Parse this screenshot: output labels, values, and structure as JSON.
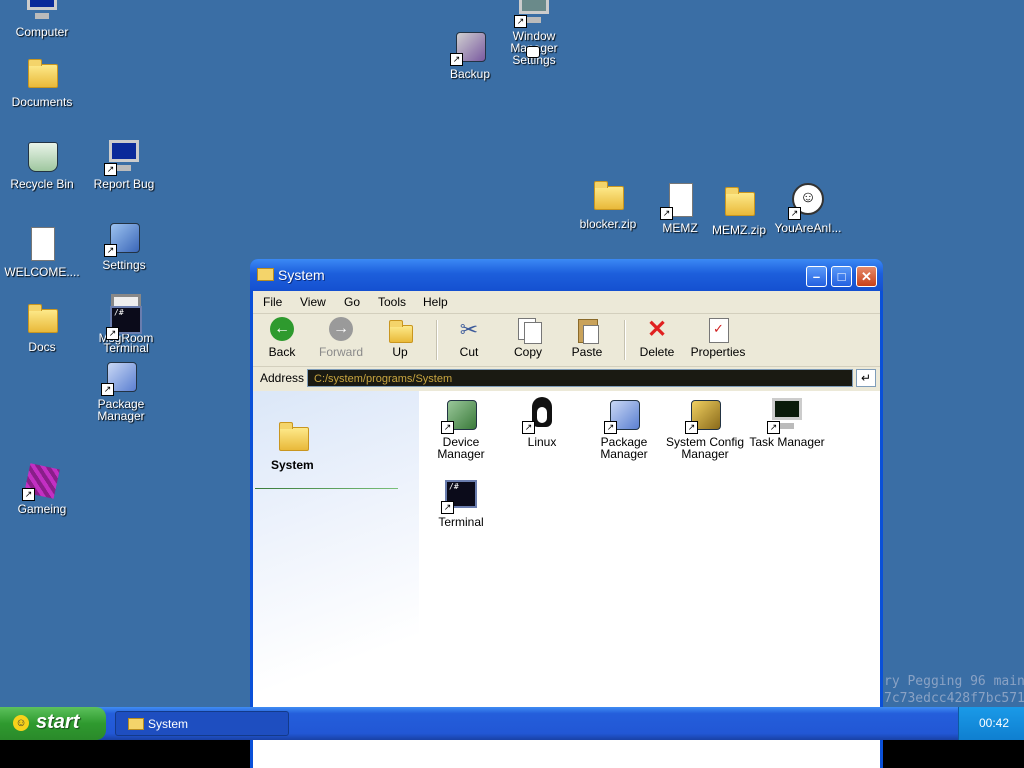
{
  "desktop": {
    "icons": {
      "computer": "Computer",
      "documents": "Documents",
      "recycle_bin": "Recycle Bin",
      "report_bug": "Report Bug",
      "welcome": "WELCOME....",
      "settings": "Settings",
      "docs": "Docs",
      "msgroom": "MsgRoom",
      "terminal": "Terminal",
      "package_manager": "Package Manager",
      "gameing": "Gameing",
      "backup": "Backup",
      "window_manager": "Window Manager Settings",
      "blocker": "blocker.zip",
      "memz": "MEMZ",
      "memz_zip": "MEMZ.zip",
      "youareanidiot": "YouAreAnI..."
    },
    "background_text_line1": "ry Pegging 96 main",
    "background_text_line2": "7c73edcc428f7bc571"
  },
  "window": {
    "title": "System",
    "menu": [
      "File",
      "View",
      "Go",
      "Tools",
      "Help"
    ],
    "toolbar": {
      "back": "Back",
      "forward": "Forward",
      "up": "Up",
      "cut": "Cut",
      "copy": "Copy",
      "paste": "Paste",
      "delete": "Delete",
      "properties": "Properties"
    },
    "address_label": "Address",
    "address_value": "C:/system/programs/System",
    "sidebar_title": "System",
    "files": {
      "device_manager": "Device Manager",
      "linux": "Linux",
      "package_manager": "Package Manager",
      "system_config": "System Config Manager",
      "task_manager": "Task Manager",
      "terminal": "Terminal"
    }
  },
  "taskbar": {
    "start_label": "start",
    "task_item": "System",
    "clock": "00:42"
  },
  "colors": {
    "desktop": "#3a6ea5",
    "titlebar": "#1d5fdc",
    "start": "#2f9a2f",
    "taskbar": "#245edb"
  }
}
